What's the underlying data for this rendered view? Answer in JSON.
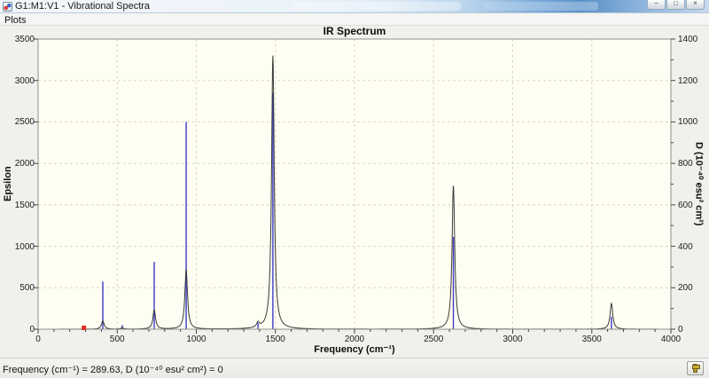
{
  "window": {
    "title": "G1:M1:V1 - Vibrational Spectra",
    "minimize_glyph": "–",
    "maximize_glyph": "□",
    "close_glyph": "×"
  },
  "menu_bar": {
    "items": [
      {
        "label": "Plots"
      }
    ]
  },
  "chart_data": {
    "type": "line",
    "title": "IR Spectrum",
    "xlabel": "Frequency (cm⁻¹)",
    "ylabel_left": "Epsilon",
    "ylabel_right": "D (10⁻⁴⁰ esu² cm²)",
    "xlim": [
      0,
      4000
    ],
    "ylim_left": [
      0,
      3500
    ],
    "ylim_right": [
      0,
      1400
    ],
    "xticks": [
      0,
      500,
      1000,
      1500,
      2000,
      2500,
      3000,
      3500,
      4000
    ],
    "xminor_step": 100,
    "yticks_left": [
      0,
      500,
      1000,
      1500,
      2000,
      2500,
      3000,
      3500
    ],
    "yticks_right": [
      0,
      200,
      400,
      600,
      800,
      1000,
      1200,
      1400
    ],
    "yminor_step_right": 100,
    "grid": {
      "show": true,
      "style": "dashed",
      "color": "#d8d8c8"
    },
    "legend": "none",
    "series": [
      {
        "name": "epsilon-lorentzian-curve",
        "axis": "left",
        "color": "#3a3a3a",
        "lorentzian_hwhm_cm1": 10,
        "peaks": [
          {
            "freq": 409,
            "epsilon": 100
          },
          {
            "freq": 532,
            "epsilon": 15
          },
          {
            "freq": 734,
            "epsilon": 230
          },
          {
            "freq": 936,
            "epsilon": 720
          },
          {
            "freq": 1390,
            "epsilon": 60
          },
          {
            "freq": 1484,
            "epsilon": 3300
          },
          {
            "freq": 2625,
            "epsilon": 1740
          },
          {
            "freq": 3624,
            "epsilon": 310
          }
        ]
      },
      {
        "name": "dipole-strength-sticks",
        "axis": "right",
        "color": "#3b3bc8",
        "points": [
          {
            "freq": 409,
            "D": 230
          },
          {
            "freq": 532,
            "D": 20
          },
          {
            "freq": 734,
            "D": 325
          },
          {
            "freq": 936,
            "D": 1000
          },
          {
            "freq": 1390,
            "D": 30
          },
          {
            "freq": 1484,
            "D": 1140
          },
          {
            "freq": 2625,
            "D": 445
          },
          {
            "freq": 3624,
            "D": 60
          }
        ]
      }
    ],
    "cursor_marker": {
      "freq": 289.63,
      "value": 0,
      "color": "#e02f23"
    }
  },
  "status_bar": {
    "text": "Frequency (cm⁻¹) = 289.63, D (10⁻⁴⁰ esu² cm²) = 0"
  },
  "colors": {
    "plot_bg": "#fffef2",
    "chart_region_bg": "#f0f0ed",
    "frame_border": "#90908a",
    "tick_color": "#444444",
    "titlebar_blue": "#5a90c6"
  }
}
